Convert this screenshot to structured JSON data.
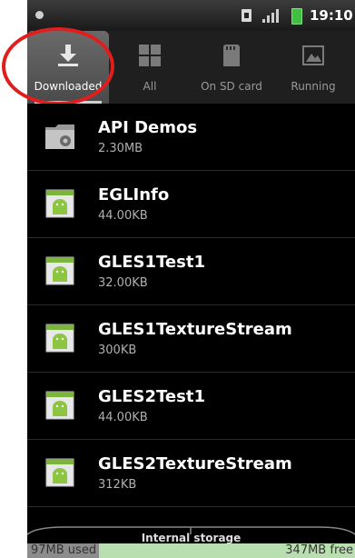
{
  "status_bar": {
    "time": "19:10",
    "icons": [
      "notification-dot-icon",
      "sim-card-icon",
      "signal-icon",
      "battery-icon"
    ]
  },
  "tabs": [
    {
      "label": "Downloaded",
      "icon": "download-icon",
      "selected": true
    },
    {
      "label": "All",
      "icon": "grid-icon",
      "selected": false
    },
    {
      "label": "On SD card",
      "icon": "sd-card-icon",
      "selected": false
    },
    {
      "label": "Running",
      "icon": "running-icon",
      "selected": false
    }
  ],
  "apps": [
    {
      "name": "API Demos",
      "size": "2.30MB",
      "icon": "folder-gear-icon"
    },
    {
      "name": "EGLInfo",
      "size": "44.00KB",
      "icon": "android-icon"
    },
    {
      "name": "GLES1Test1",
      "size": "32.00KB",
      "icon": "android-icon"
    },
    {
      "name": "GLES1TextureStream",
      "size": "300KB",
      "icon": "android-icon"
    },
    {
      "name": "GLES2Test1",
      "size": "44.00KB",
      "icon": "android-icon"
    },
    {
      "name": "GLES2TextureStream",
      "size": "312KB",
      "icon": "android-icon"
    }
  ],
  "storage": {
    "title": "Internal storage",
    "used": "97MB used",
    "free": "347MB free",
    "used_fraction": 0.22
  },
  "colors": {
    "highlight": "#e11d1d",
    "free_bar": "#b9dfb1",
    "used_bar": "#8c8c8c"
  }
}
